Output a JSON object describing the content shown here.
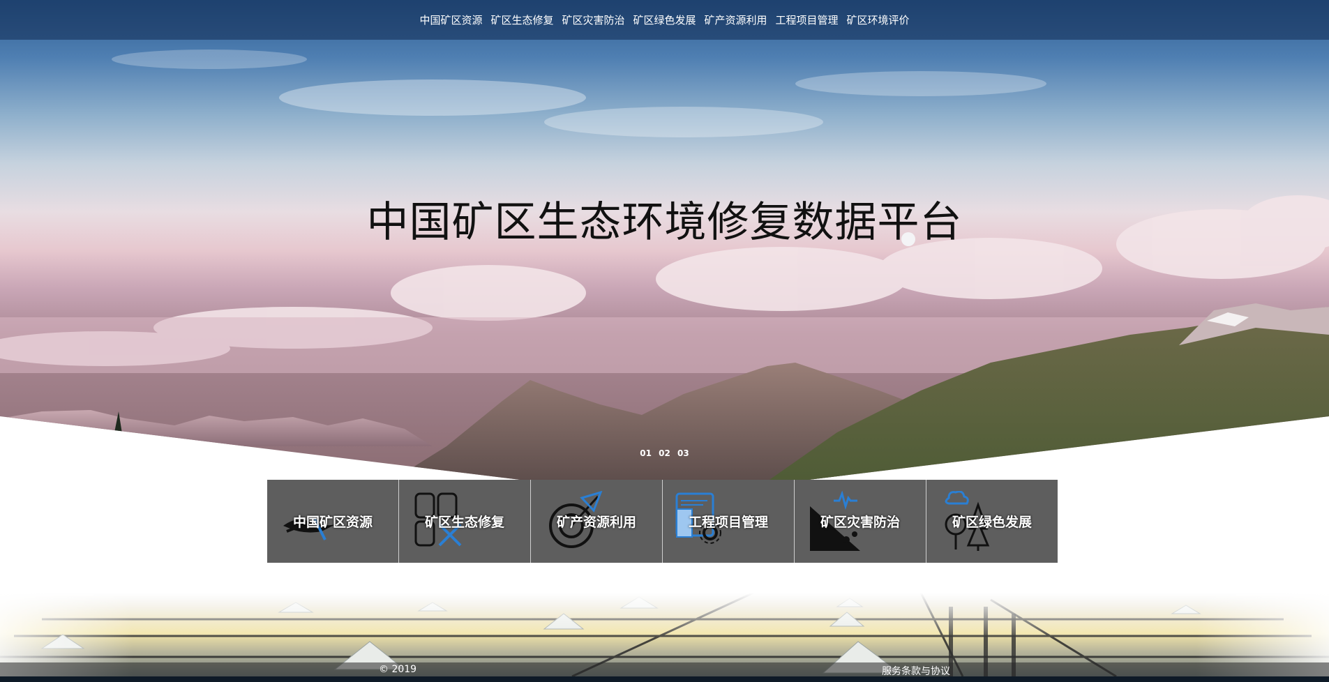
{
  "nav": {
    "items": [
      "中国矿区资源",
      "矿区生态修复",
      "矿区灾害防治",
      "矿区绿色发展",
      "矿产资源利用",
      "工程项目管理",
      "矿区环境评价"
    ]
  },
  "hero": {
    "title": "中国矿区生态环境修复数据平台",
    "slides": [
      "01",
      "02",
      "03"
    ]
  },
  "cards": [
    {
      "label": "中国矿区资源",
      "icon": "mine-pickaxe-icon"
    },
    {
      "label": "矿区生态修复",
      "icon": "ecology-repair-icon"
    },
    {
      "label": "矿产资源利用",
      "icon": "resource-target-icon"
    },
    {
      "label": "工程项目管理",
      "icon": "project-gear-icon"
    },
    {
      "label": "矿区灾害防治",
      "icon": "disaster-slope-icon"
    },
    {
      "label": "矿区绿色发展",
      "icon": "green-trees-icon"
    }
  ],
  "footer": {
    "copyright": "© 2019",
    "terms": "服务条款与协议"
  },
  "colors": {
    "nav_bg": "#102a52",
    "card_bg": "#5e5e5e",
    "icon_accent": "#2a7fd4",
    "bottom_bar": "#0e1a27"
  }
}
